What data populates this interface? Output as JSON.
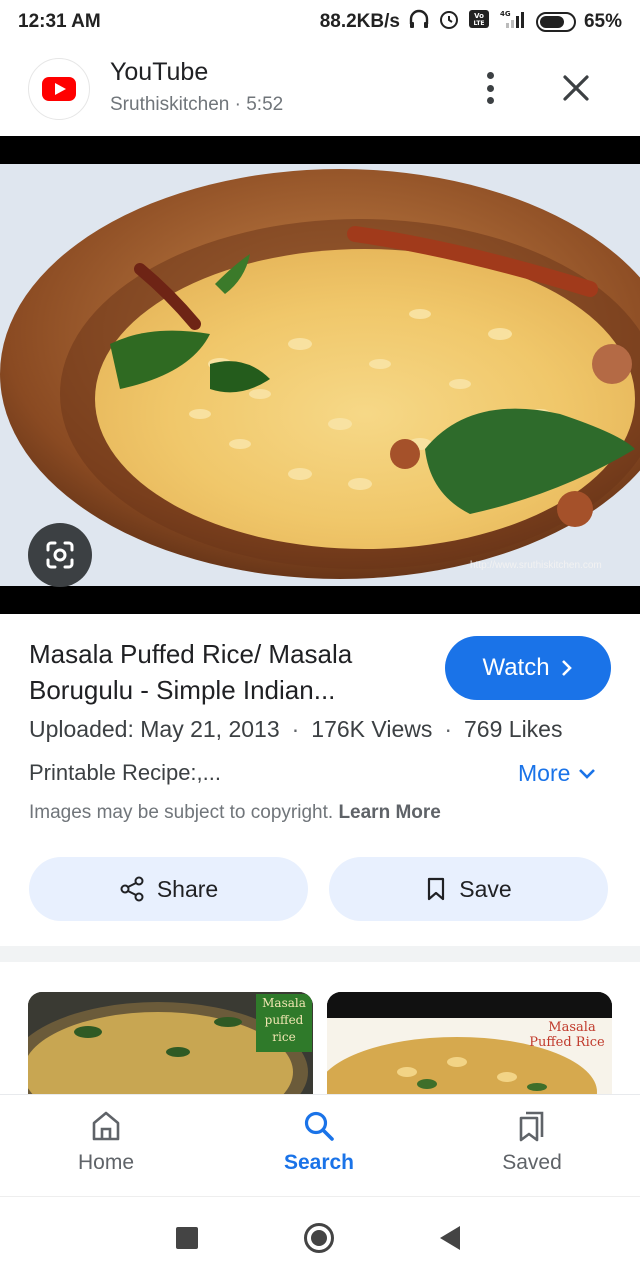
{
  "status": {
    "time": "12:31 AM",
    "speed": "88.2KB/s",
    "network": "4G",
    "volte": "Vo LTE",
    "battery": "65%"
  },
  "header": {
    "app_name": "YouTube",
    "subtitle": "Sruthiskitchen · 5:52"
  },
  "image": {
    "watermark": "http://www.sruthiskitchen.com"
  },
  "result": {
    "title": "Masala Puffed Rice/ Masala Borugulu - Simple Indian...",
    "watch_label": "Watch",
    "uploaded": "Uploaded: May 21, 2013",
    "views": "176K Views",
    "likes": "769 Likes",
    "description": "Printable Recipe:,...",
    "more_label": "More",
    "copyright": "Images may be subject to copyright.",
    "learn_more": "Learn More",
    "share_label": "Share",
    "save_label": "Save"
  },
  "related": [
    {
      "caption": "Masala puffed rice"
    },
    {
      "caption": "Masala Puffed Rice"
    }
  ],
  "bottom_nav": [
    {
      "label": "Home",
      "icon": "home-icon",
      "active": false
    },
    {
      "label": "Search",
      "icon": "search-icon",
      "active": true
    },
    {
      "label": "Saved",
      "icon": "saved-icon",
      "active": false
    }
  ],
  "colors": {
    "accent": "#1a73e8",
    "pill_bg": "#e8f0fe",
    "youtube_red": "#ff0000"
  }
}
